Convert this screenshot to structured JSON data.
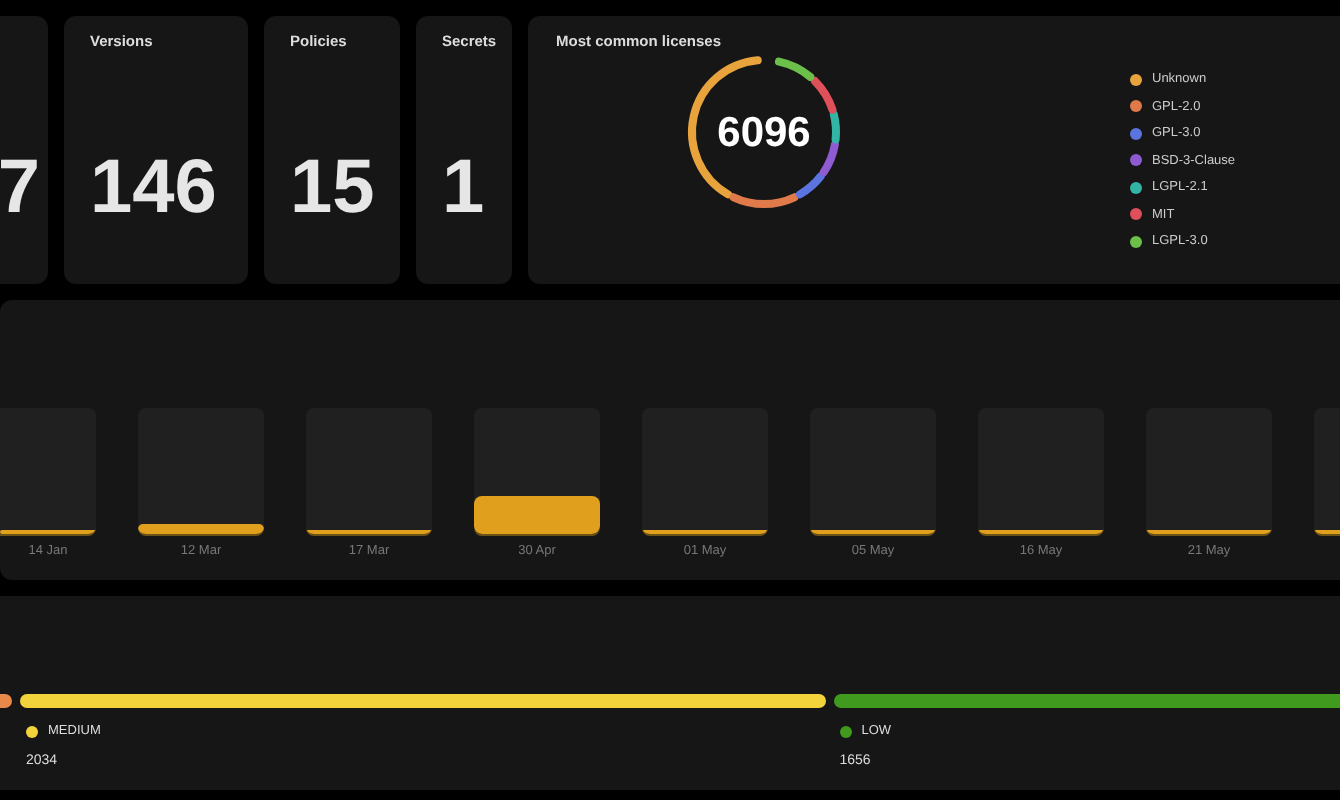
{
  "stats": [
    {
      "value": "7"
    },
    {
      "title": "Versions",
      "value": "146"
    },
    {
      "title": "Policies",
      "value": "15"
    },
    {
      "title": "Secrets",
      "value": "1"
    }
  ],
  "licenses": {
    "title": "Most common licenses",
    "total": "6096",
    "legend": [
      {
        "label": "Unknown",
        "color": "#e8a33d"
      },
      {
        "label": "GPL-2.0",
        "color": "#e07a4b"
      },
      {
        "label": "GPL-3.0",
        "color": "#5b74e0"
      },
      {
        "label": "BSD-3-Clause",
        "color": "#8e5bd0"
      },
      {
        "label": "LGPL-2.1",
        "color": "#33b5a5"
      },
      {
        "label": "MIT",
        "color": "#e0505a"
      },
      {
        "label": "LGPL-3.0",
        "color": "#6cc04a"
      }
    ]
  },
  "timeline": [
    {
      "label": "14 Jan",
      "level": 0.02
    },
    {
      "label": "12 Mar",
      "level": 0.08
    },
    {
      "label": "17 Mar",
      "level": 0.01
    },
    {
      "label": "30 Apr",
      "level": 0.3
    },
    {
      "label": "01 May",
      "level": 0.02
    },
    {
      "label": "05 May",
      "level": 0.02
    },
    {
      "label": "16 May",
      "level": 0.03
    },
    {
      "label": "21 May",
      "level": 0.01
    },
    {
      "level": 0.02
    }
  ],
  "severities": [
    {
      "color": "#e8884a"
    },
    {
      "label": "MEDIUM",
      "count": "2034",
      "color": "#f2d33c"
    },
    {
      "label": "LOW",
      "count": "1656",
      "color": "#3f9a1e"
    }
  ]
}
